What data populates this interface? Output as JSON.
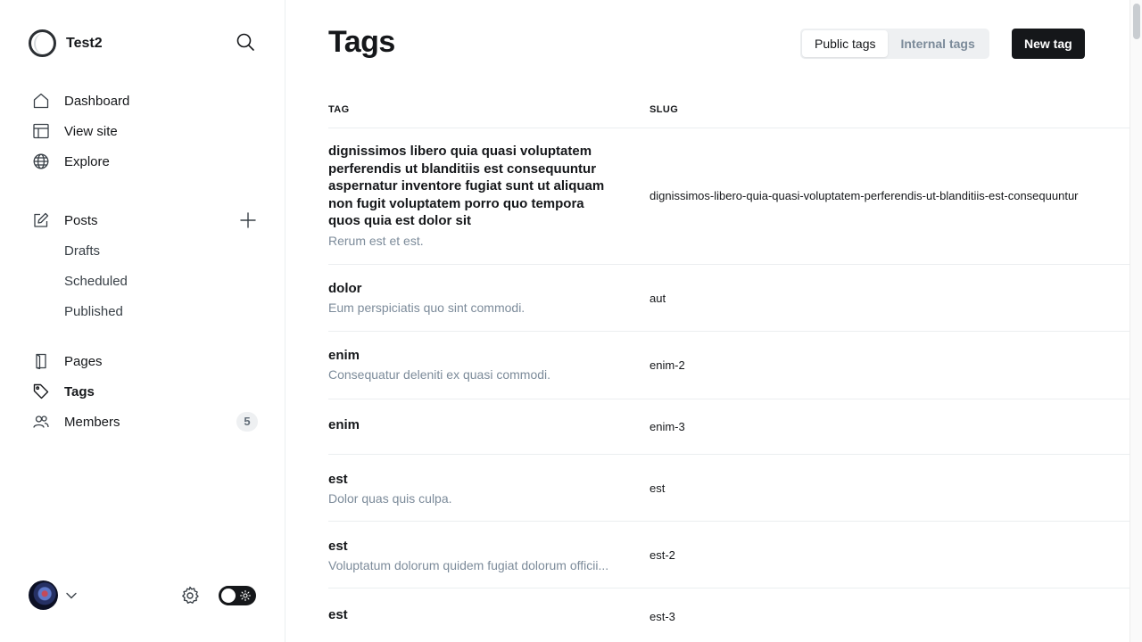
{
  "app": {
    "site_name": "Test2"
  },
  "sidebar": {
    "primary": [
      {
        "label": "Dashboard",
        "icon": "home-icon"
      },
      {
        "label": "View site",
        "icon": "layout-icon"
      },
      {
        "label": "Explore",
        "icon": "globe-icon"
      }
    ],
    "posts": {
      "label": "Posts",
      "icon": "pencil-icon",
      "children": [
        {
          "label": "Drafts"
        },
        {
          "label": "Scheduled"
        },
        {
          "label": "Published"
        }
      ]
    },
    "secondary": [
      {
        "label": "Pages",
        "icon": "page-icon"
      },
      {
        "label": "Tags",
        "icon": "tag-icon",
        "active": true
      },
      {
        "label": "Members",
        "icon": "members-icon",
        "count": "5"
      }
    ]
  },
  "header": {
    "title": "Tags",
    "tabs": [
      {
        "label": "Public tags",
        "active": true
      },
      {
        "label": "Internal tags",
        "active": false
      }
    ],
    "new_button": "New tag"
  },
  "table": {
    "columns": [
      "TAG",
      "SLUG"
    ],
    "rows": [
      {
        "name": "dignissimos libero quia quasi voluptatem perferendis ut blanditiis est consequuntur aspernatur inventore fugiat sunt ut aliquam non fugit voluptatem porro quo tempora quos quia est dolor sit",
        "description": "Rerum est et est.",
        "slug": "dignissimos-libero-quia-quasi-voluptatem-perferendis-ut-blanditiis-est-consequuntur"
      },
      {
        "name": "dolor",
        "description": "Eum perspiciatis quo sint commodi.",
        "slug": "aut"
      },
      {
        "name": "enim",
        "description": "Consequatur deleniti ex quasi commodi.",
        "slug": "enim-2"
      },
      {
        "name": "enim",
        "description": "",
        "slug": "enim-3"
      },
      {
        "name": "est",
        "description": "Dolor quas quis culpa.",
        "slug": "est"
      },
      {
        "name": "est",
        "description": "Voluptatum dolorum quidem fugiat dolorum officii...",
        "slug": "est-2"
      },
      {
        "name": "est",
        "description": "",
        "slug": "est-3"
      }
    ]
  },
  "colors": {
    "accent_dark": "#15171a",
    "muted_text": "#7c8b9a",
    "divider": "#ebeef0"
  }
}
